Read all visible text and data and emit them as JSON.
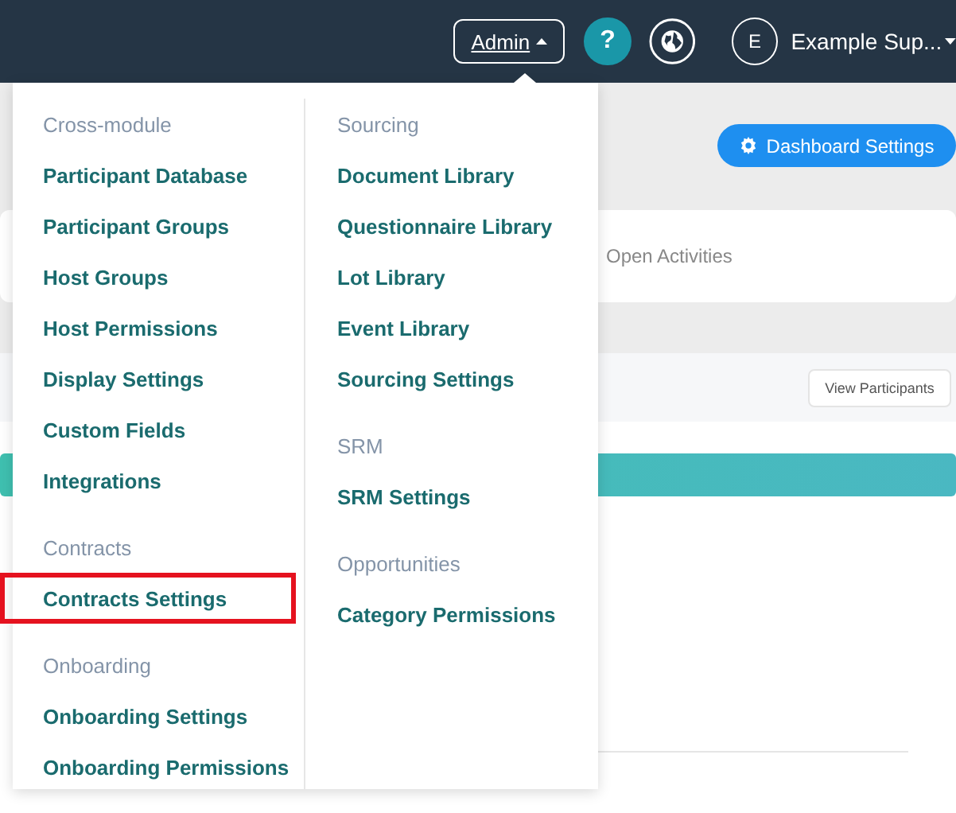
{
  "header": {
    "admin_label": "Admin",
    "help_label": "?",
    "avatar_initial": "E",
    "user_name": "Example Sup..."
  },
  "page": {
    "dashboard_button": "Dashboard Settings",
    "summary_text": "Open Activities",
    "view_button": "View Participants"
  },
  "admin_menu": {
    "columns": [
      {
        "sections": [
          {
            "heading": "Cross-module",
            "items": [
              {
                "label": "Participant Database",
                "highlighted": false
              },
              {
                "label": "Participant Groups",
                "highlighted": false
              },
              {
                "label": "Host Groups",
                "highlighted": false
              },
              {
                "label": "Host Permissions",
                "highlighted": false
              },
              {
                "label": "Display Settings",
                "highlighted": false
              },
              {
                "label": "Custom Fields",
                "highlighted": false
              },
              {
                "label": "Integrations",
                "highlighted": false
              }
            ]
          },
          {
            "heading": "Contracts",
            "items": [
              {
                "label": "Contracts Settings",
                "highlighted": true
              }
            ]
          },
          {
            "heading": "Onboarding",
            "items": [
              {
                "label": "Onboarding Settings",
                "highlighted": false
              },
              {
                "label": "Onboarding Permissions",
                "highlighted": false
              }
            ]
          }
        ]
      },
      {
        "sections": [
          {
            "heading": "Sourcing",
            "items": [
              {
                "label": "Document Library",
                "highlighted": false
              },
              {
                "label": "Questionnaire Library",
                "highlighted": false
              },
              {
                "label": "Lot Library",
                "highlighted": false
              },
              {
                "label": "Event Library",
                "highlighted": false
              },
              {
                "label": "Sourcing Settings",
                "highlighted": false
              }
            ]
          },
          {
            "heading": "SRM",
            "items": [
              {
                "label": "SRM Settings",
                "highlighted": false
              }
            ]
          },
          {
            "heading": "Opportunities",
            "items": [
              {
                "label": "Category Permissions",
                "highlighted": false
              }
            ]
          }
        ]
      }
    ]
  }
}
